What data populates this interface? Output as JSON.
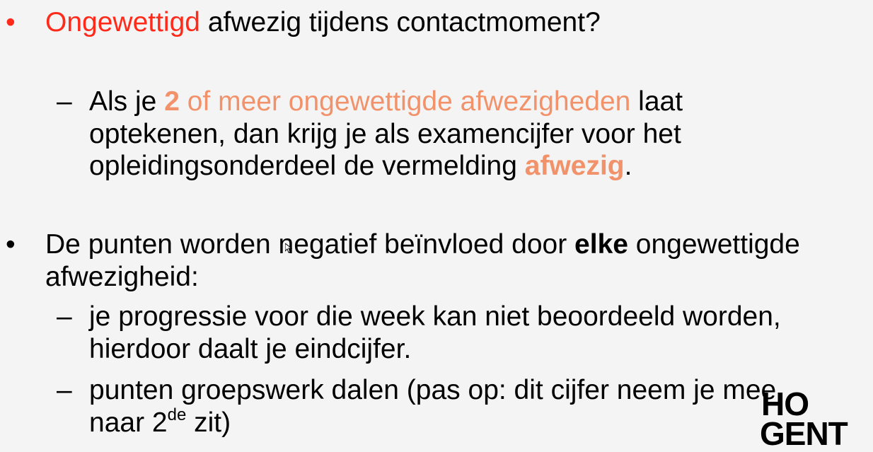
{
  "slide": {
    "bullet_glyph": "•",
    "dash_glyph": "–",
    "item1": {
      "highlight": "Ongewettigd",
      "rest": " afwezig tijdens contactmoment?"
    },
    "sub1": {
      "line1_pre": "Als je ",
      "line1_num": "2",
      "line1_orange": " of meer ongewettigde afwezigheden",
      "line1_post": " laat",
      "line2": "optekenen, dan krijg je als examencijfer voor het",
      "line3_pre": "opleidingsonderdeel de vermelding ",
      "line3_bold": "afwezig",
      "line3_post": "."
    },
    "item2": {
      "line1_pre": "De punten worden negatief beïnvloed door ",
      "line1_bold": "elke",
      "line1_post": " ongewettigde",
      "line2": "afwezigheid:"
    },
    "sub2": {
      "line1": "je progressie voor die  week kan niet beoordeeld worden,",
      "line2": "hierdoor daalt je eindcijfer."
    },
    "sub3": {
      "line1": "punten groepswerk dalen (pas op: dit cijfer neem je mee",
      "line2_pre": "naar 2",
      "line2_sup": "de",
      "line2_post": " zit)"
    },
    "logo": {
      "top": "HO",
      "bottom": "GENT"
    }
  },
  "colors": {
    "red": "#ff2a1a",
    "orange": "#f2926a",
    "background": "#f4f4f4"
  }
}
